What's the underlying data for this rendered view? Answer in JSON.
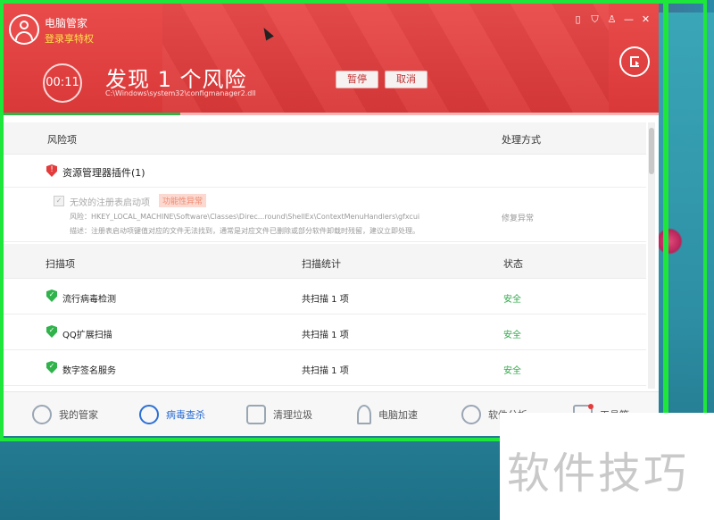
{
  "app": {
    "title": "电脑管家",
    "vip_link": "登录享特权"
  },
  "window_controls": [
    "phone-icon",
    "shield-icon",
    "shirt-icon",
    "minimize-icon",
    "close-icon"
  ],
  "scan": {
    "timer": "00:11",
    "headline": "发现 1 个风险",
    "path": "C:\\Windows\\system32\\configmanager2.dll",
    "pause_label": "暂停",
    "cancel_label": "取消"
  },
  "risk_table": {
    "col_item": "风险项",
    "col_action": "处理方式",
    "group_label": "资源管理器插件(1)",
    "detail": {
      "name": "无效的注册表启动项",
      "tag": "功能性异常",
      "line1": "风险：HKEY_LOCAL_MACHINE\\Software\\Classes\\Direc...round\\ShellEx\\ContextMenuHandlers\\gfxcui",
      "line2": "描述：注册表启动项键值对应的文件无法找到，通常是对应文件已删除或部分软件卸载时残留，建议立即处理。",
      "action": "修复异常"
    }
  },
  "scan_table": {
    "col_item": "扫描项",
    "col_stat": "扫描统计",
    "col_status": "状态",
    "rows": [
      {
        "name": "流行病毒检测",
        "stat": "共扫描 1 项",
        "status": "安全"
      },
      {
        "name": "QQ扩展扫描",
        "stat": "共扫描 1 项",
        "status": "安全"
      },
      {
        "name": "数字签名服务",
        "stat": "共扫描 1 项",
        "status": "安全"
      }
    ]
  },
  "nav": {
    "items": [
      {
        "label": "我的管家",
        "icon": "user-icon"
      },
      {
        "label": "病毒查杀",
        "icon": "virus-scan-icon"
      },
      {
        "label": "清理垃圾",
        "icon": "broom-icon"
      },
      {
        "label": "电脑加速",
        "icon": "rocket-icon"
      },
      {
        "label": "软件分析",
        "icon": "software-icon"
      },
      {
        "label": "工具箱",
        "icon": "toolbox-icon"
      }
    ]
  },
  "watermark": "软件技巧",
  "colors": {
    "header_red": "#e94b4b",
    "safe_green": "#2fa84a",
    "active_blue": "#2c6fd6",
    "frame_green": "#1ee63a"
  }
}
